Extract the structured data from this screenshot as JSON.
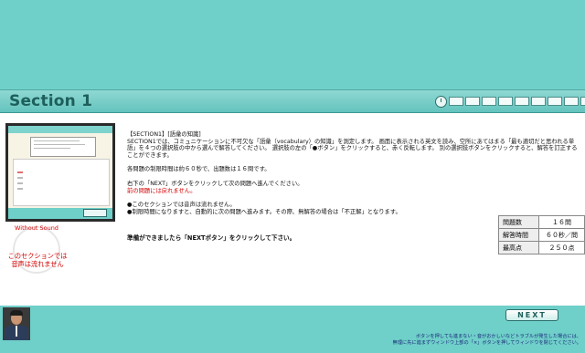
{
  "header": {
    "title": "Section 1"
  },
  "nav": {
    "icons": [
      "clock-icon"
    ],
    "question_count": 10
  },
  "description": {
    "heading": "【SECTION1】[語彙の知識]",
    "para1": "SECTION1では、コミュニケーションに不可欠な「語彙（vocabulary）の知識」を測定します。 画面に表示される英文を読み、空所にあてはまる「最も適切だと思われる単語」を４つの選択肢の中から選んで解答してください。 選択肢の左の「●ボタン」をクリックすると、赤く反転します。 別の選択肢ボタンをクリックすると、解答を訂正することができます。",
    "para2": "各問題の制限時間は約６０秒で、出題数は１６問です。",
    "para3": "右下の「NEXT」ボタンをクリックして次の問題へ進んでください。",
    "para3_red": "前の問題には戻れません。",
    "para4_line1": "●このセクションでは音声は流れません。",
    "para4_line2": "●制限時間になりますと、自動的に次の問題へ進みます。その際、無解答の場合は「不正解」となります。"
  },
  "sound": {
    "label_en": "Without Sound",
    "label_jp_line1": "このセクションでは",
    "label_jp_line2": "音声は流れません"
  },
  "ready_text": "準備ができましたら「NEXTボタン」をクリックして下さい。",
  "stats": [
    {
      "key": "問題数",
      "value": "１６問"
    },
    {
      "key": "解答時間",
      "value": "６０秒／問"
    },
    {
      "key": "最高点",
      "value": "２５０点"
    }
  ],
  "footer": {
    "next_label": "NEXT",
    "note_line1": "ボタンを押しても進まない・音がおかしいなどトラブルが発生した場合には、",
    "note_line2": "無理に先に進まずウィンドウ上部の「×」ボタンを押してウィンドウを閉じてください。"
  },
  "colors": {
    "accent": "#6fcfc9",
    "title": "#1e5f5b",
    "warning": "#d40000"
  }
}
